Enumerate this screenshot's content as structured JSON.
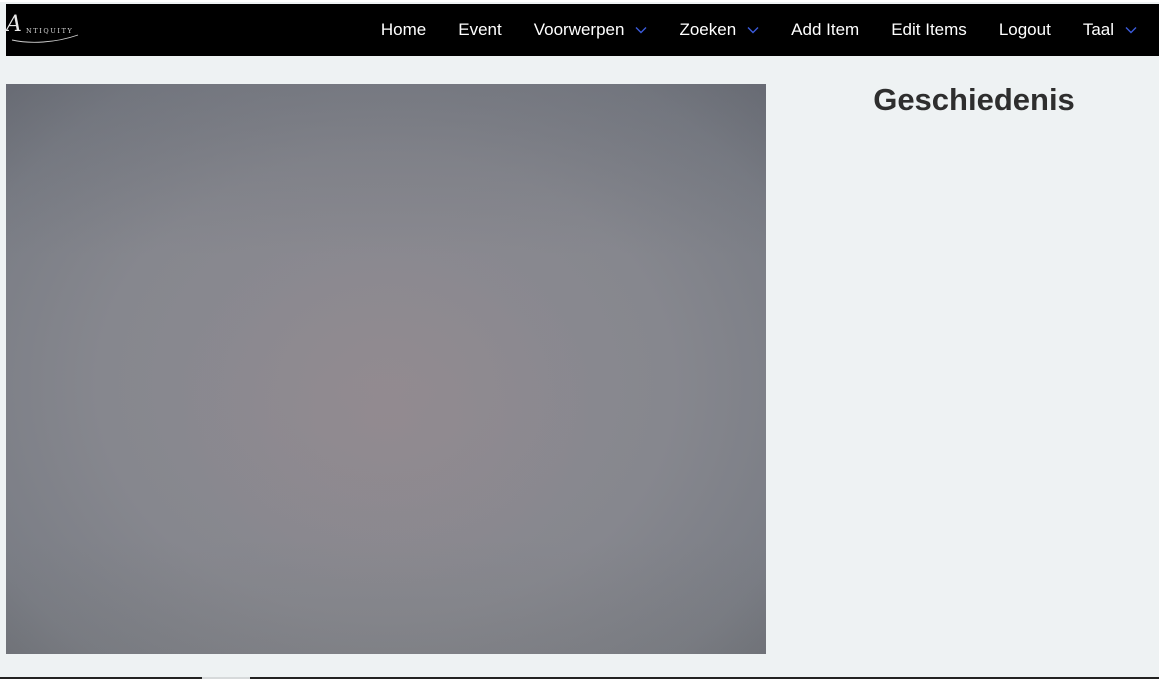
{
  "brand": {
    "logo_initial": "A",
    "logo_text": "NTIQUITY"
  },
  "nav": {
    "items": [
      {
        "label": "Home",
        "dropdown": false
      },
      {
        "label": "Event",
        "dropdown": false
      },
      {
        "label": "Voorwerpen",
        "dropdown": true
      },
      {
        "label": "Zoeken",
        "dropdown": true
      },
      {
        "label": "Add Item",
        "dropdown": false
      },
      {
        "label": "Edit Items",
        "dropdown": false
      },
      {
        "label": "Logout",
        "dropdown": false
      },
      {
        "label": "Taal",
        "dropdown": true
      }
    ]
  },
  "main": {
    "history_title": "Geschiedenis"
  },
  "colors": {
    "navbar_bg": "#000000",
    "nav_text": "#ffffff",
    "chevron": "#3b5bdb",
    "page_bg": "#eef2f3",
    "title_text": "#2e2e2e"
  }
}
